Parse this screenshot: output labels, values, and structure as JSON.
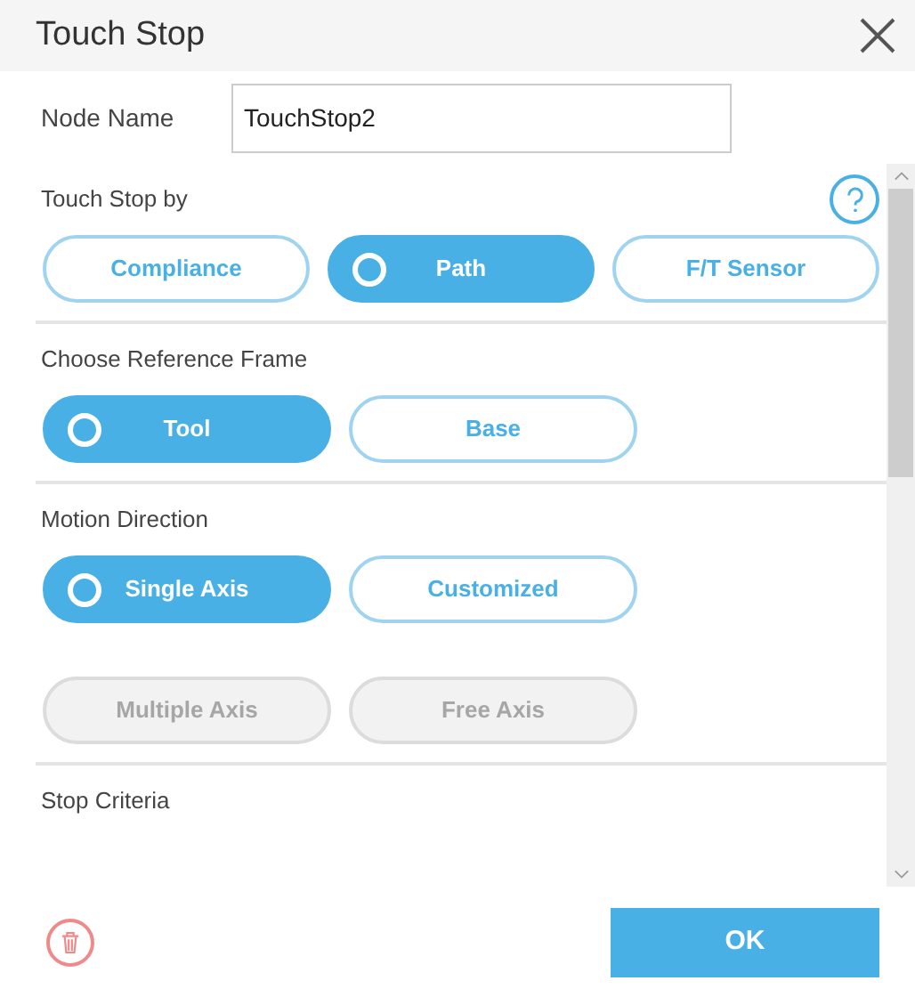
{
  "window": {
    "title": "Touch Stop"
  },
  "node_name": {
    "label": "Node Name",
    "value": "TouchStop2"
  },
  "sections": [
    {
      "label": "Touch Stop by",
      "help": true,
      "rows": [
        [
          {
            "label": "Compliance",
            "selected": false,
            "disabled": false
          },
          {
            "label": "Path",
            "selected": true,
            "disabled": false
          },
          {
            "label": "F/T Sensor",
            "selected": false,
            "disabled": false
          }
        ]
      ]
    },
    {
      "label": "Choose Reference Frame",
      "rows": [
        [
          {
            "label": "Tool",
            "selected": true,
            "disabled": false
          },
          {
            "label": "Base",
            "selected": false,
            "disabled": false
          }
        ]
      ]
    },
    {
      "label": "Motion Direction",
      "rows": [
        [
          {
            "label": "Single Axis",
            "selected": true,
            "disabled": false
          },
          {
            "label": "Customized",
            "selected": false,
            "disabled": false
          }
        ],
        [
          {
            "label": "Multiple Axis",
            "selected": false,
            "disabled": true
          },
          {
            "label": "Free Axis",
            "selected": false,
            "disabled": true
          }
        ]
      ]
    },
    {
      "label": "Stop Criteria"
    }
  ],
  "footer": {
    "ok": "OK"
  }
}
